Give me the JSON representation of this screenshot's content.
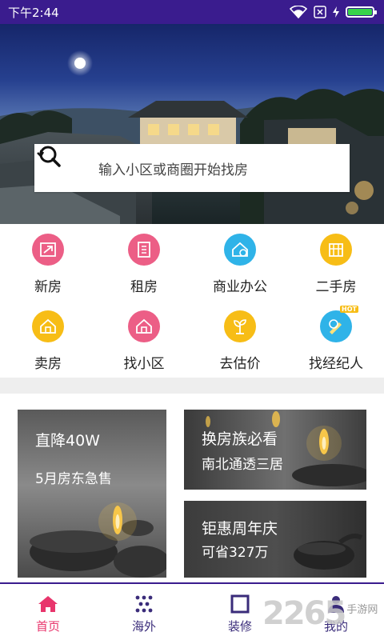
{
  "status_bar": {
    "time": "下午2:44",
    "icons": [
      "wifi-icon",
      "sim-icon",
      "charging-icon",
      "battery-icon"
    ]
  },
  "search": {
    "placeholder": "输入小区或商圈开始找房"
  },
  "categories": [
    {
      "label": "新房",
      "icon": "new-house-icon",
      "color": "#ec5e86"
    },
    {
      "label": "租房",
      "icon": "rent-icon",
      "color": "#ec5e86"
    },
    {
      "label": "商业办公",
      "icon": "office-icon",
      "color": "#2fb3e8"
    },
    {
      "label": "二手房",
      "icon": "second-hand-icon",
      "color": "#f7bd16"
    },
    {
      "label": "卖房",
      "icon": "sell-house-icon",
      "color": "#f7bd16"
    },
    {
      "label": "找小区",
      "icon": "community-icon",
      "color": "#ec5e86"
    },
    {
      "label": "去估价",
      "icon": "valuation-icon",
      "color": "#f7bd16"
    },
    {
      "label": "找经纪人",
      "icon": "agent-icon",
      "color": "#2fb3e8",
      "badge": "HOT"
    }
  ],
  "promos": [
    {
      "title": "直降40W",
      "subtitle": "5月房东急售"
    },
    {
      "title": "换房族必看",
      "subtitle": "南北通透三居"
    },
    {
      "title": "钜惠周年庆",
      "subtitle": "可省327万"
    }
  ],
  "bottom_nav": [
    {
      "label": "首页",
      "icon": "home-icon",
      "active": true
    },
    {
      "label": "海外",
      "icon": "overseas-icon",
      "active": false
    },
    {
      "label": "装修",
      "icon": "decoration-icon",
      "active": false
    },
    {
      "label": "我的",
      "icon": "profile-icon",
      "active": false
    }
  ],
  "watermark": {
    "number": "2265",
    "text": "手游网"
  },
  "colors": {
    "status_bar": "#3a1c8e",
    "accent": "#e8356c",
    "nav_text": "#3a2c7a",
    "pink": "#ec5e86",
    "blue": "#2fb3e8",
    "yellow": "#f7bd16"
  }
}
